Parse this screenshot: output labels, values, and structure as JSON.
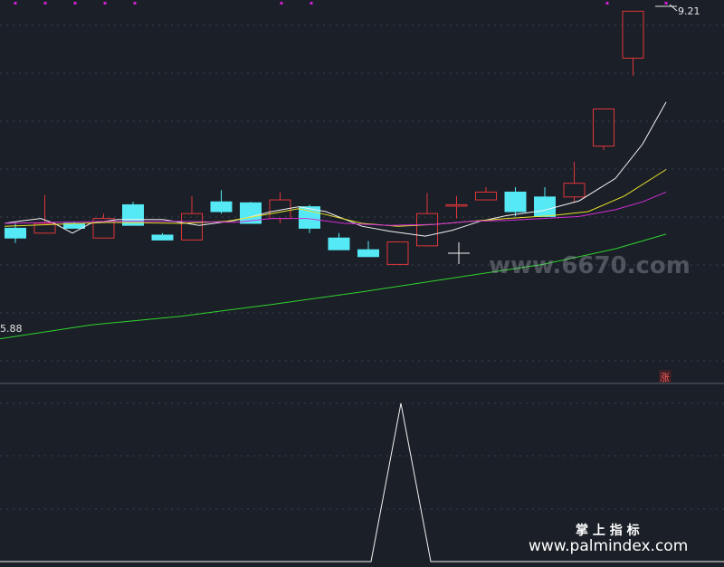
{
  "labels": {
    "price_high": "9.21",
    "price_low": "5.88",
    "rise_marker": "涨"
  },
  "watermarks": {
    "center": "www.6670.com",
    "title": "掌 上 指 标",
    "url": "www.palmindex.com"
  },
  "colors": {
    "background": "#1b1f27",
    "up": "#e0363b",
    "down": "#54e9f5",
    "ma_white": "#f2f2f2",
    "ma_yellow": "#e6e02c",
    "ma_magenta": "#d22ed8",
    "ma_green": "#2fd42f",
    "marker_dot": "#d21fd5",
    "grid": "#3a414f"
  },
  "chart_data": [
    {
      "type": "candlestick",
      "title": "",
      "price_range": [
        5.88,
        9.21
      ],
      "candles": [
        {
          "o": 6.94,
          "c": 6.84,
          "h": 6.99,
          "l": 6.79
        },
        {
          "o": 6.89,
          "c": 6.99,
          "h": 7.28,
          "l": 6.89
        },
        {
          "o": 6.99,
          "c": 6.94,
          "h": 7.01,
          "l": 6.94
        },
        {
          "o": 6.84,
          "c": 7.04,
          "h": 7.09,
          "l": 6.84
        },
        {
          "o": 7.18,
          "c": 6.97,
          "h": 7.21,
          "l": 6.97
        },
        {
          "o": 6.87,
          "c": 6.82,
          "h": 6.89,
          "l": 6.82
        },
        {
          "o": 6.82,
          "c": 7.09,
          "h": 7.27,
          "l": 6.82
        },
        {
          "o": 7.21,
          "c": 7.11,
          "h": 7.33,
          "l": 7.09
        },
        {
          "o": 7.2,
          "c": 6.99,
          "h": 7.21,
          "l": 6.99
        },
        {
          "o": 7.04,
          "c": 7.23,
          "h": 7.31,
          "l": 6.99
        },
        {
          "o": 7.16,
          "c": 6.94,
          "h": 7.18,
          "l": 6.89
        },
        {
          "o": 6.84,
          "c": 6.72,
          "h": 6.89,
          "l": 6.72
        },
        {
          "o": 6.72,
          "c": 6.65,
          "h": 6.81,
          "l": 6.65
        },
        {
          "o": 6.57,
          "c": 6.8,
          "h": 6.8,
          "l": 6.57
        },
        {
          "o": 6.76,
          "c": 7.09,
          "h": 7.3,
          "l": 6.76
        },
        {
          "o": 7.18,
          "c": 7.18,
          "h": 7.27,
          "l": 7.04
        },
        {
          "o": 7.23,
          "c": 7.31,
          "h": 7.36,
          "l": 7.23
        },
        {
          "o": 7.31,
          "c": 7.11,
          "h": 7.36,
          "l": 7.06
        },
        {
          "o": 7.26,
          "c": 7.06,
          "h": 7.36,
          "l": 7.06
        },
        {
          "o": 7.26,
          "c": 7.4,
          "h": 7.62,
          "l": 7.21
        },
        {
          "o": 7.78,
          "c": 8.16,
          "h": 8.16,
          "l": 7.74
        },
        {
          "o": 8.68,
          "c": 9.16,
          "h": 9.16,
          "l": 8.5
        }
      ],
      "moving_averages": [
        {
          "color": "#f2f2f2",
          "values": [
            [
              5,
              6.99
            ],
            [
              20,
              7.01
            ],
            [
              45,
              7.04
            ],
            [
              60,
              6.99
            ],
            [
              80,
              6.89
            ],
            [
              100,
              6.99
            ],
            [
              130,
              7.03
            ],
            [
              180,
              7.03
            ],
            [
              220,
              6.97
            ],
            [
              260,
              7.02
            ],
            [
              300,
              7.11
            ],
            [
              330,
              7.16
            ],
            [
              360,
              7.11
            ],
            [
              400,
              6.96
            ],
            [
              430,
              6.91
            ],
            [
              470,
              6.86
            ],
            [
              500,
              6.92
            ],
            [
              530,
              7.01
            ],
            [
              560,
              7.07
            ],
            [
              600,
              7.12
            ],
            [
              640,
              7.22
            ],
            [
              680,
              7.45
            ],
            [
              710,
              7.8
            ],
            [
              736,
              8.23
            ]
          ]
        },
        {
          "color": "#e6e02c",
          "values": [
            [
              5,
              6.96
            ],
            [
              60,
              6.98
            ],
            [
              120,
              7.0
            ],
            [
              200,
              6.99
            ],
            [
              250,
              7.01
            ],
            [
              300,
              7.09
            ],
            [
              330,
              7.14
            ],
            [
              360,
              7.08
            ],
            [
              400,
              6.99
            ],
            [
              440,
              6.96
            ],
            [
              480,
              6.98
            ],
            [
              520,
              7.01
            ],
            [
              560,
              7.04
            ],
            [
              610,
              7.07
            ],
            [
              650,
              7.11
            ],
            [
              690,
              7.27
            ],
            [
              736,
              7.54
            ]
          ]
        },
        {
          "color": "#d22ed8",
          "values": [
            [
              5,
              6.99
            ],
            [
              60,
              7.0
            ],
            [
              120,
              7.01
            ],
            [
              200,
              7.01
            ],
            [
              260,
              7.0
            ],
            [
              300,
              7.04
            ],
            [
              340,
              7.04
            ],
            [
              380,
              6.99
            ],
            [
              430,
              6.97
            ],
            [
              480,
              6.98
            ],
            [
              520,
              7.01
            ],
            [
              560,
              7.02
            ],
            [
              600,
              7.04
            ],
            [
              640,
              7.06
            ],
            [
              680,
              7.13
            ],
            [
              710,
              7.21
            ],
            [
              736,
              7.31
            ]
          ]
        },
        {
          "color": "#2fd42f",
          "values": [
            [
              0,
              5.81
            ],
            [
              100,
              5.95
            ],
            [
              200,
              6.04
            ],
            [
              300,
              6.16
            ],
            [
              400,
              6.29
            ],
            [
              500,
              6.43
            ],
            [
              600,
              6.57
            ],
            [
              680,
              6.73
            ],
            [
              736,
              6.88
            ]
          ]
        }
      ]
    },
    {
      "type": "line",
      "title": "",
      "series": [
        {
          "values": [
            [
              0,
              0
            ],
            [
              410,
              0
            ],
            [
              443,
              1
            ],
            [
              476,
              0
            ],
            [
              800,
              0
            ]
          ]
        }
      ]
    }
  ]
}
